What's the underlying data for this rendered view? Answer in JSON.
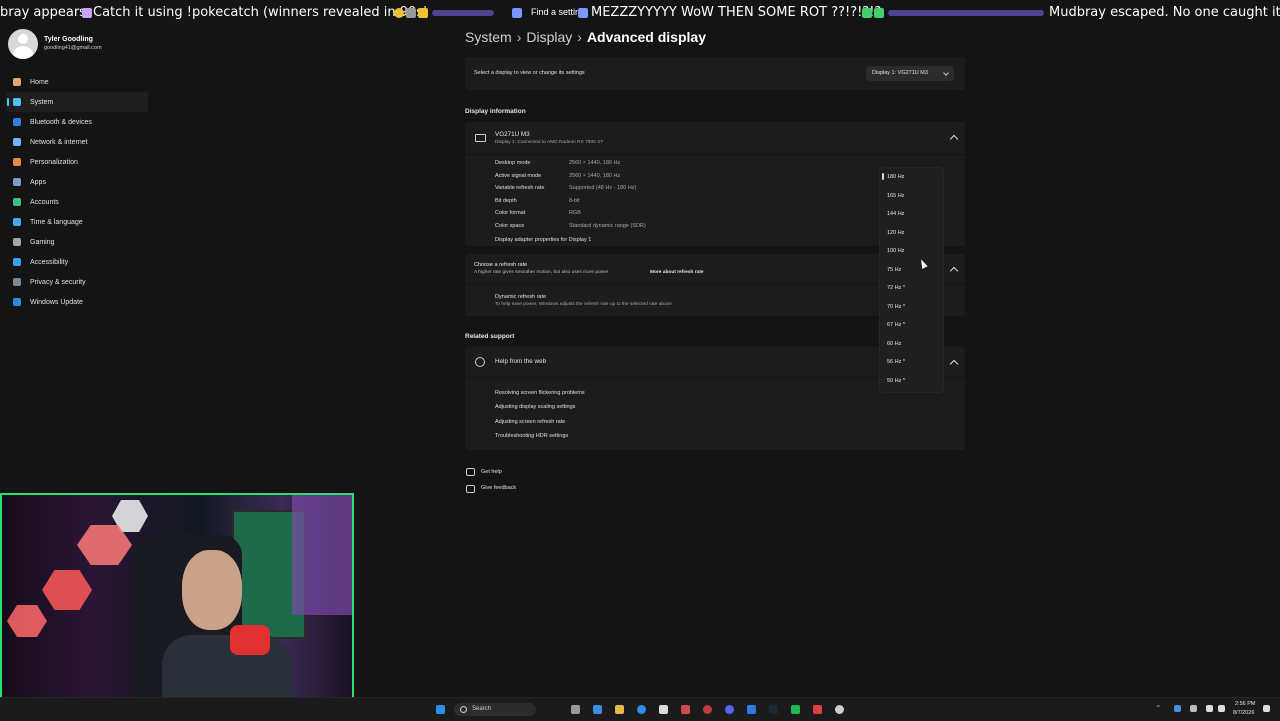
{
  "ticker": {
    "seg1": "bray appears",
    "seg2": "Catch it using !pokecatch (winners revealed in 90s)",
    "seg3": "Find a setting",
    "seg4": "MEZZZYYYYY WoW THEN SOME ROT ??!?!?!?",
    "seg5": "Mudbray escaped. No one caught it."
  },
  "sidebar": {
    "user_name": "Tyler Goodling",
    "user_email": "goodling41@gmail.com",
    "items": [
      {
        "label": "Home",
        "icon": "home-icon",
        "color": "#e0a96d"
      },
      {
        "label": "System",
        "icon": "monitor-icon",
        "color": "#4cc2ff"
      },
      {
        "label": "Bluetooth & devices",
        "icon": "bluetooth-icon",
        "color": "#2f7fe6"
      },
      {
        "label": "Network & internet",
        "icon": "wifi-icon",
        "color": "#6fb6ff"
      },
      {
        "label": "Personalization",
        "icon": "brush-icon",
        "color": "#e58a4a"
      },
      {
        "label": "Apps",
        "icon": "apps-icon",
        "color": "#7c9cc7"
      },
      {
        "label": "Accounts",
        "icon": "person-icon",
        "color": "#3fbf7f"
      },
      {
        "label": "Time & language",
        "icon": "globe-icon",
        "color": "#4aa6e8"
      },
      {
        "label": "Gaming",
        "icon": "gamepad-icon",
        "color": "#a5a5a5"
      },
      {
        "label": "Accessibility",
        "icon": "accessibility-icon",
        "color": "#3aa0f0"
      },
      {
        "label": "Privacy & security",
        "icon": "shield-icon",
        "color": "#7a8899"
      },
      {
        "label": "Windows Update",
        "icon": "update-icon",
        "color": "#2f89e0"
      }
    ]
  },
  "breadcrumb": {
    "part1": "System",
    "part2": "Display",
    "current": "Advanced display",
    "sep": "›"
  },
  "display_select": {
    "label": "Select a display to view or change its settings",
    "value": "Display 1: VG271U M3"
  },
  "display_info": {
    "section_label": "Display information",
    "monitor_name": "VG271U M3",
    "monitor_sub": "Display 1: Connected to AMD Radeon RX 7900 XT",
    "rows": [
      {
        "key": "Desktop mode",
        "value": "2560 × 1440, 180 Hz"
      },
      {
        "key": "Active signal mode",
        "value": "2560 × 1440, 180 Hz"
      },
      {
        "key": "Variable refresh rate",
        "value": "Supported (48 Hz - 180 Hz)"
      },
      {
        "key": "Bit depth",
        "value": "8-bit"
      },
      {
        "key": "Color format",
        "value": "RGB"
      },
      {
        "key": "Color space",
        "value": "Standard dynamic range (SDR)"
      }
    ],
    "adapter_link": "Display adapter properties for Display 1"
  },
  "refresh": {
    "title": "Choose a refresh rate",
    "desc": "A higher rate gives smoother motion, but also uses more power",
    "link": "More about refresh rate",
    "dynamic_title": "Dynamic refresh rate",
    "dynamic_desc": "To help save power, Windows adjusts the refresh rate up to the selected rate above",
    "options": [
      "180 Hz",
      "165 Hz",
      "144 Hz",
      "120 Hz",
      "100 Hz",
      "75 Hz",
      "72 Hz *",
      "70 Hz *",
      "67 Hz *",
      "60 Hz",
      "56 Hz *",
      "50 Hz *"
    ],
    "selected": "180 Hz"
  },
  "support": {
    "section_label": "Related support",
    "help_title": "Help from the web",
    "links": [
      "Resolving screen flickering problems",
      "Adjusting display scaling settings",
      "Adjusting screen refresh rate",
      "Troubleshooting HDR settings"
    ]
  },
  "footer": {
    "get_help": "Get help",
    "give_feedback": "Give feedback"
  },
  "taskbar": {
    "search": "Search",
    "time": "2:56 PM",
    "date": "8/7/2026"
  }
}
